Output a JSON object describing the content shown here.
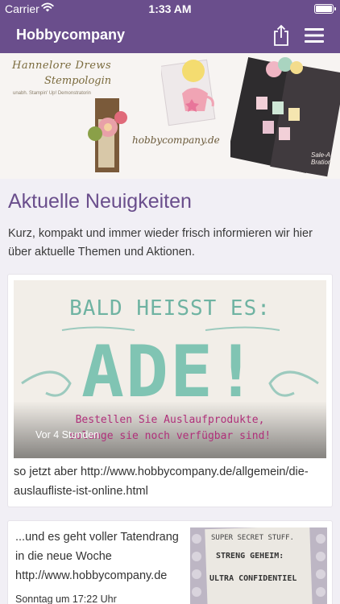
{
  "status_bar": {
    "carrier": "Carrier",
    "time": "1:33 AM",
    "wifi_icon": "wifi-icon",
    "battery_icon": "battery-icon"
  },
  "nav": {
    "title": "Hobbycompany",
    "share_icon": "share-icon",
    "menu_icon": "hamburger-menu-icon"
  },
  "hero": {
    "signature_line1": "Hannelore Drews",
    "signature_line2": "Stempologin",
    "signature_line3": "unabh. Stampin' Up! Demonstratorin",
    "website": "hobbycompany.de",
    "catalog_cover_text": "Sale-A-Bration"
  },
  "section": {
    "title": "Aktuelle Neuigkeiten",
    "intro": "Kurz, kompakt und immer wieder frisch informieren wir hier über aktuelle Themen und Aktionen."
  },
  "posts": [
    {
      "image_text_top": "BALD HEISST ES:",
      "image_text_main": "ADE!",
      "image_text_bottom1": "Bestellen Sie Auslaufprodukte,",
      "image_text_bottom2": "solange sie noch verfügbar sind!",
      "timestamp": "Vor 4 Stunden",
      "text": "so jetzt aber http://www.hobbycompany.de/allgemein/die-auslaufliste-ist-online.html"
    },
    {
      "text": "...und es geht voller Tatendrang in die neue Woche http://www.hobbycompany.de",
      "timestamp": "Sonntag um 17:22 Uhr",
      "image_line1": "SUPER SECRET STUFF.",
      "image_line2": "STRENG GEHEIM:",
      "image_line3": "ULTRA CONFIDENTIEL"
    }
  ],
  "colors": {
    "brand_purple": "#6a4e8c",
    "background": "#f1eff5",
    "teal": "#7ec3b2",
    "magenta": "#b0307a"
  }
}
